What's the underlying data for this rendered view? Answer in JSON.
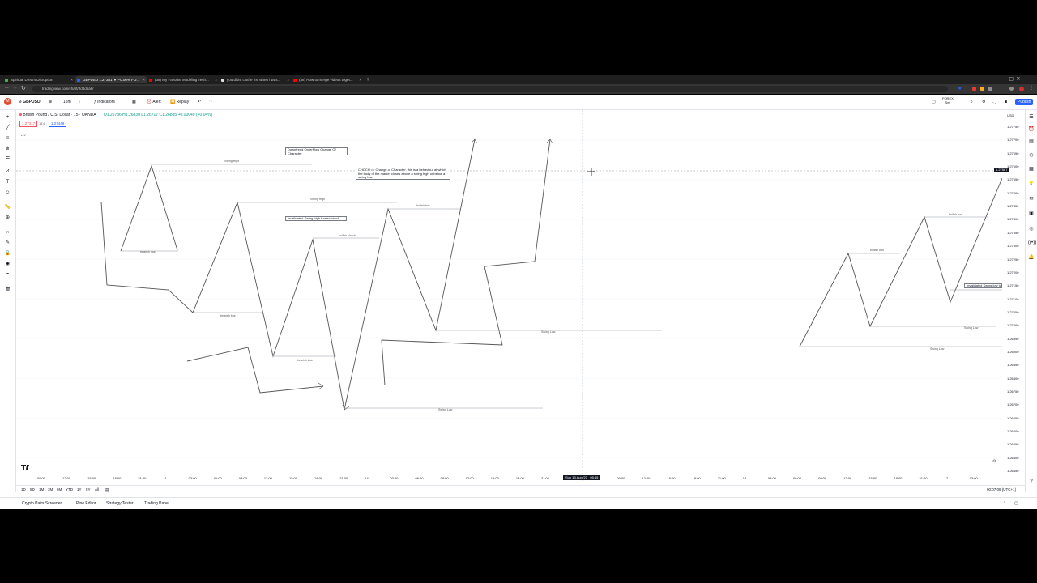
{
  "browser": {
    "tabs": [
      {
        "title": "Spiritual Dream Disruption",
        "color": "#4caf50"
      },
      {
        "title": "GBPUSD 1.27381 ▼ −0.06% FO...",
        "color": "#2962ff"
      },
      {
        "title": "(38) My Favorite Modeling Tech...",
        "color": "#ff0000"
      },
      {
        "title": "you didnt clothe me when i was...",
        "color": "#dddddd"
      },
      {
        "title": "(38) How to merge videos toget...",
        "color": "#ff0000"
      }
    ],
    "new_tab": "+",
    "url": "tradingview.com/chart/2d8d5a6/"
  },
  "toolbar": {
    "avatar": "M",
    "symbol": "GBPUSD",
    "interval": "15m",
    "indicators": "Indicators",
    "alert": "Alert",
    "replay": "Replay",
    "market": "FOREX",
    "market_sub": "Sell",
    "publish": "Publish"
  },
  "legend": {
    "title": "British Pound / U.S. Dollar · 15 · OANDA",
    "ohlc": "O1.26786 H1.26830 L1.26717 C1.26835 +0.00049 (+0.04%)",
    "sell": "1.27317",
    "spread": "17.6",
    "buy": "1.27449",
    "collapse": "2"
  },
  "annotations": {
    "note1": "Downtrend OrderFlow Change Of Character",
    "note2": "CHOCH == Change of Character, this is a behaviour at which the body of the market closes above a swing high or below a swing low.",
    "note3": "Invalidated Swing high turned choch",
    "note4": "Invalidated Swing low tu",
    "labels": {
      "swing_high_1": "Swing High",
      "swing_high_2": "Swing High",
      "bearish_bos_1": "bearish bos",
      "bearish_bos_2": "bearish bos",
      "bearish_bos_3": "bearish bos",
      "bullish_choch": "bullish choch",
      "bullish_bos_1": "bullish bos",
      "bullish_bos_2": "bullish bos",
      "bullish_bos_3": "bullish bos",
      "swing_low_1": "Swing Low",
      "swing_low_2": "Swing Low",
      "swing_low_3": "Swing Low",
      "swing_low_4": "Swing Low"
    }
  },
  "price_axis": {
    "currency": "USD",
    "labels": [
      "1.27750",
      "1.27700",
      "1.27650",
      "1.27600",
      "1.27550",
      "1.27500",
      "1.27450",
      "1.27400",
      "1.27350",
      "1.27300",
      "1.27250",
      "1.27200",
      "1.27150",
      "1.27100",
      "1.27050",
      "1.27000",
      "1.26950",
      "1.26900",
      "1.26850",
      "1.26800",
      "1.26750",
      "1.26700",
      "1.26650",
      "1.26600",
      "1.26550",
      "1.26500",
      "1.26450"
    ],
    "current": "1.27567"
  },
  "time_axis": {
    "labels": [
      "09:00",
      "12:00",
      "15:00",
      "18:00",
      "21:00",
      "11",
      "03:00",
      "06:00",
      "09:00",
      "12:00",
      "15:00",
      "18:00",
      "21:00",
      "14",
      "03:00",
      "06:00",
      "09:00",
      "12:00",
      "15:00",
      "18:00",
      "21:00",
      "06:00",
      "09:00",
      "12:00",
      "15:00",
      "18:00",
      "21:00",
      "16",
      "03:00",
      "06:00",
      "09:00",
      "12:00",
      "15:00",
      "18:00",
      "21:00",
      "17",
      "03:00"
    ],
    "cursor": "Sun 13 Aug '23   05:45"
  },
  "ranges": [
    "1D",
    "5D",
    "1M",
    "3M",
    "6M",
    "YTD",
    "1Y",
    "5Y",
    "All"
  ],
  "clock": "00:07:08 (UTC+1)",
  "panels": [
    "Crypto Pairs Screener",
    "Pine Editor",
    "Strategy Tester",
    "Trading Panel"
  ]
}
